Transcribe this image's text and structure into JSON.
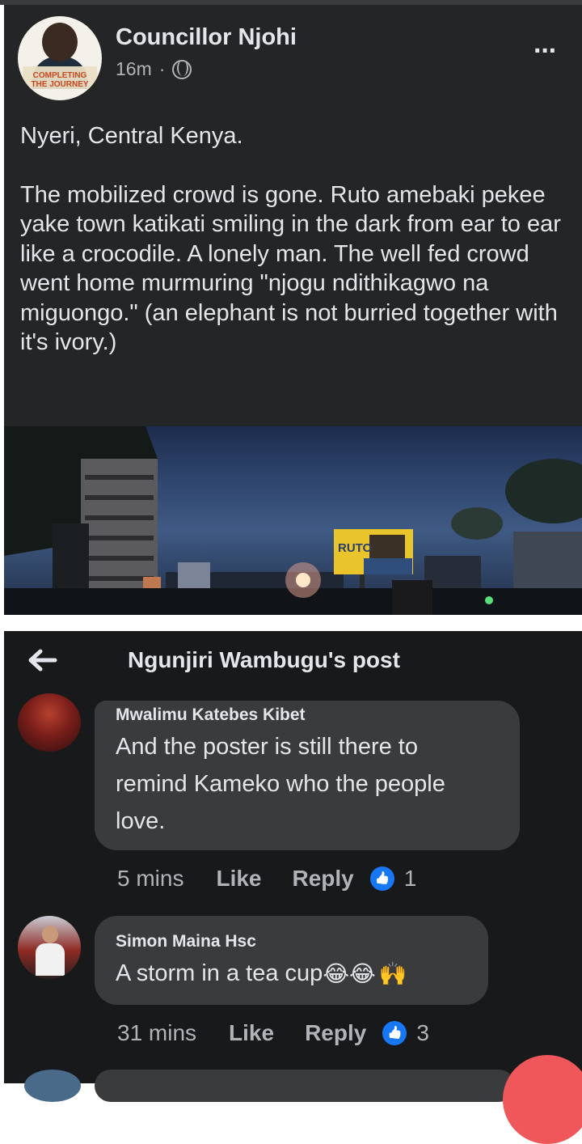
{
  "post": {
    "author": "Councillor Njohi",
    "time": "16m",
    "separator": "·",
    "avatar_line1": "COMPLETING",
    "avatar_line2": "THE JOURNEY",
    "more_icon": "···",
    "paragraph1": "Nyeri, Central Kenya.",
    "paragraph2": "The mobilized crowd is gone. Ruto amebaki pekee yake town katikati smiling in the dark from ear to ear like a crocodile. A lonely man. The well fed crowd went home murmuring \"njogu ndithikagwo na miguongo.\" (an elephant is not burried together with it's ivory.)",
    "billboard_text": "RUTO"
  },
  "comments_panel": {
    "title": "Ngunjiri Wambugu's post",
    "comments": [
      {
        "name": "Mwalimu Katebes Kibet",
        "lines": [
          "And the poster is still there to",
          "remind Kameko who the people",
          "love."
        ],
        "time": "5 mins",
        "like": "Like",
        "reply": "Reply",
        "reactions": "1"
      },
      {
        "name": "Simon Maina Hsc",
        "text": "A storm in a tea cup",
        "emojis": [
          "😂",
          "😂",
          "🙌"
        ],
        "time": "31 mins",
        "like": "Like",
        "reply": "Reply",
        "reactions": "3"
      }
    ]
  },
  "colors": {
    "post_bg": "#242526",
    "panel_bg": "#18191a",
    "bubble_bg": "#3a3b3c",
    "like_blue": "#1877f2",
    "fab_red": "#f0575b"
  }
}
